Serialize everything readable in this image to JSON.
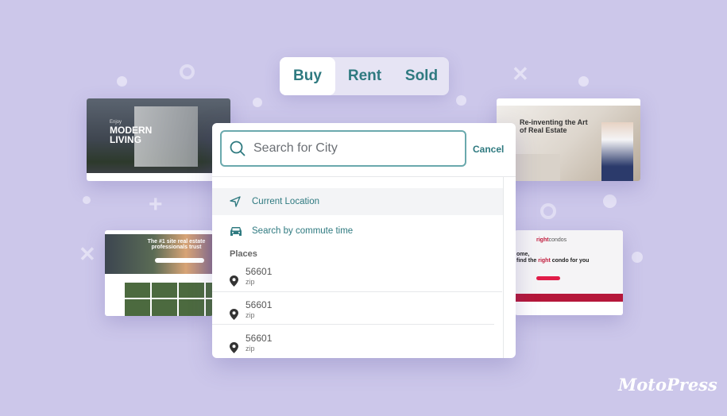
{
  "tabs": [
    {
      "label": "Buy",
      "active": true
    },
    {
      "label": "Rent",
      "active": false
    },
    {
      "label": "Sold",
      "active": false
    }
  ],
  "search": {
    "placeholder": "Search for City",
    "value": "",
    "cancel_label": "Cancel"
  },
  "options": {
    "current_location": "Current Location",
    "commute": "Search by commute time"
  },
  "places": {
    "heading": "Places",
    "items": [
      {
        "value": "56601",
        "type": "zip"
      },
      {
        "value": "56601",
        "type": "zip"
      },
      {
        "value": "56601",
        "type": "zip"
      }
    ]
  },
  "thumbnails": {
    "modern": {
      "line1": "Enjoy",
      "line2": "MODERN",
      "line3": "LIVING"
    },
    "art": {
      "headline": "Re-inventing the Art of Real Estate"
    },
    "realtor": {
      "headline": "The #1 site real estate professionals trust"
    },
    "condos": {
      "brand_a": "right",
      "brand_b": "condos",
      "headline_a": "ome,",
      "headline_b": "find the ",
      "headline_c": "right",
      "headline_d": " condo for you"
    }
  },
  "brand": {
    "logo": "MotoPress"
  },
  "colors": {
    "accent": "#2f7a80",
    "background": "#ccc7ea",
    "condo_red": "#c0193a"
  }
}
